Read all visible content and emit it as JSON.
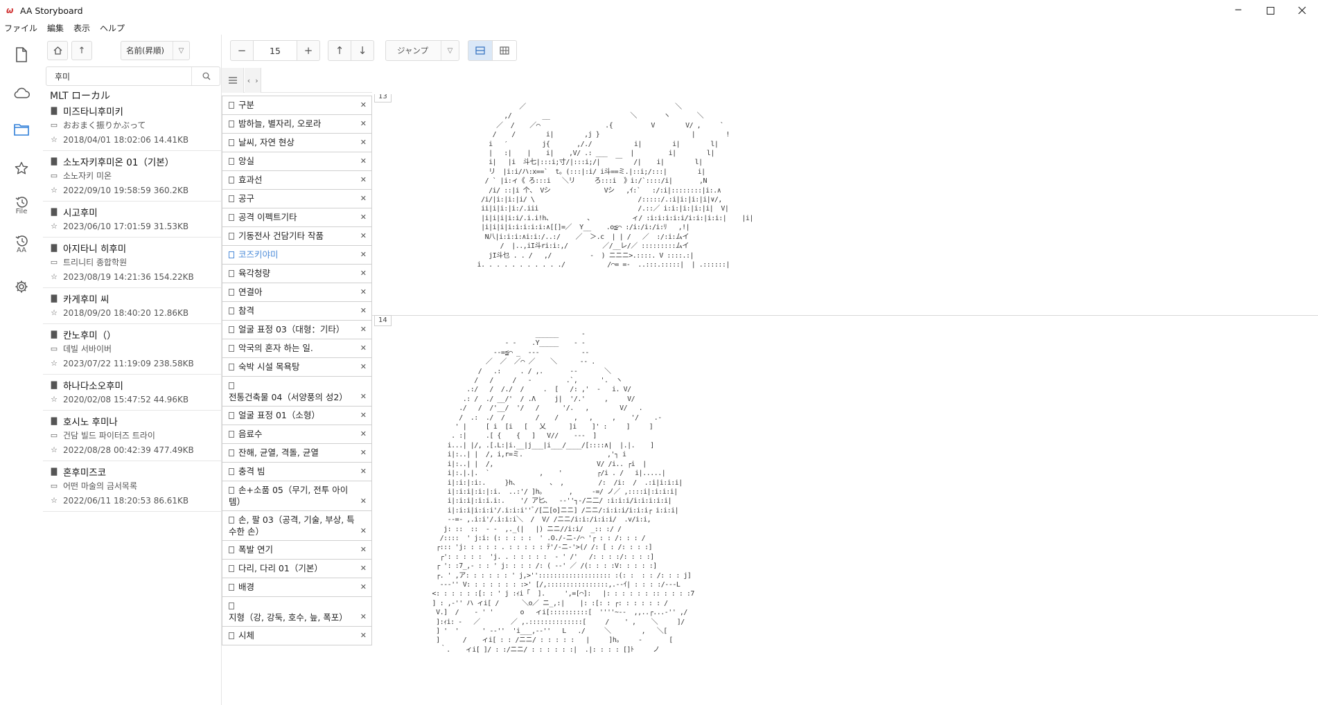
{
  "window": {
    "title": "AA Storyboard",
    "logo": "ω"
  },
  "menu": [
    "ファイル",
    "編集",
    "表示",
    "ヘルプ"
  ],
  "activity": [
    {
      "name": "new-document-icon",
      "label": ""
    },
    {
      "name": "cloud-icon",
      "label": ""
    },
    {
      "name": "folder-icon",
      "label": ""
    },
    {
      "name": "star-icon",
      "label": ""
    },
    {
      "name": "history-file-icon",
      "label": "File"
    },
    {
      "name": "history-aa-icon",
      "label": "AA"
    },
    {
      "name": "settings-gear-icon",
      "label": ""
    }
  ],
  "filepanel": {
    "sort_label": "名前(昇順)",
    "search_value": "후미",
    "location": "MLT ローカル",
    "files": [
      {
        "title": "미즈타니후미키",
        "folder": "おおまく振りかぶって",
        "meta": "2018/04/01 18:02:06 14.41KB"
      },
      {
        "title": "소노자키후미온 01（기본）",
        "folder": "소노자키 미온",
        "meta": "2022/09/10 19:58:59 360.2KB"
      },
      {
        "title": "시고후미",
        "folder": null,
        "meta": "2023/06/10 17:01:59 31.53KB"
      },
      {
        "title": "아지타니 히후미",
        "folder": "트리니티 종합학원",
        "meta": "2023/08/19 14:21:36 154.22KB"
      },
      {
        "title": "카게후미 씨",
        "folder": null,
        "meta": "2018/09/20 18:40:20 12.86KB"
      },
      {
        "title": "칸노후미（）",
        "folder": "데빌 서바이버",
        "meta": "2023/07/22 11:19:09 238.58KB"
      },
      {
        "title": "하나다소오후미",
        "folder": null,
        "meta": "2020/02/08 15:47:52 44.96KB"
      },
      {
        "title": "호시노 후미나",
        "folder": "건담 빌드 파이터즈 트라이",
        "meta": "2022/08/28 00:42:39 477.49KB"
      },
      {
        "title": "혼후미즈코",
        "folder": "어떤 마술의 금서목록",
        "meta": "2022/06/11 18:20:53 86.61KB"
      }
    ]
  },
  "toolbar": {
    "minus": "−",
    "page_value": "15",
    "plus": "+",
    "up": "↑",
    "down": "↓",
    "jump_label": "ジャンプ"
  },
  "sections": [
    {
      "label": "구분"
    },
    {
      "label": "밤하늘, 별자리, 오로라"
    },
    {
      "label": "날씨, 자연 현상"
    },
    {
      "label": "앙실"
    },
    {
      "label": "효과선"
    },
    {
      "label": "공구"
    },
    {
      "label": "공격 이펙트기타"
    },
    {
      "label": "기동전사 건담기타 작품"
    },
    {
      "label": "코즈키야미",
      "selected": true
    },
    {
      "label": "육각청량"
    },
    {
      "label": "연결아"
    },
    {
      "label": "참격"
    },
    {
      "label": "얼굴 표정 03（대형：기타）"
    },
    {
      "label": "악국의 혼자 하는 일."
    },
    {
      "label": "숙박 시설 목욕탕"
    },
    {
      "label": "전통건축물 04（서양풍의 성2）"
    },
    {
      "label": "얼굴 표정 01（소형）"
    },
    {
      "label": "음료수"
    },
    {
      "label": "잔해, 균열, 격돌, 균열"
    },
    {
      "label": "충격 빔"
    },
    {
      "label": "손+소품 05（무기, 전투 아이템）"
    },
    {
      "label": "손, 팔 03（공격, 기술, 부상, 특수한 손）"
    },
    {
      "label": "폭발 연기"
    },
    {
      "label": "다리, 다리 01（기본）"
    },
    {
      "label": "배경"
    },
    {
      "label": "지형（강, 강둑, 호수, 늪, 폭포）"
    },
    {
      "label": "시체"
    }
  ],
  "preview": {
    "pages": [
      "13",
      "14"
    ],
    "art1": "              ／                                       ＼\n          ,/        __                     ＼       ヽ       ＼\n        ／  /    ／⌒                 .{          V        V/ ,     `\n       /    /        i|        ,j }                        |        !\n      i   ′         j{       ,/./           i|        i|        l|\n      |   :|    |    i|    ,V/ .: ___      |         i|        l|\n      i|   |i  斗七|:::i;寸/|:::i;/|    ￣   /|    i|        l|\n      リ  |i:i/ハ:x==`  t。(:::|:i/ i斗==ミ.|::i;/:::|        i|\n     / ` |i:ィ《 ろ:::i   ＼リ     ろ:::i  》i:/`::::/i|       ,N\n      /i/ ::|i 个、 Vシ              Vシ   ,ｲ:`   :/:i|::::::::|i:.∧\n    /i/|i:|i:|i/ \\                           /:::::/.:i|i:|i:|i|∨/,\n    ii|i|i:|i:/.iii                          /.::／ i:i:|i:|i:|i|  V|\n    |i|i|i|i:i/.i.i!h、         、          ィ/ :i:i:i:i:i/i:i:|i:i:|    |i|\n    |i|i|i|i:i:i:i:i:∧[[]=／  Y__    .o≦⌒ :/i:/i:/i:ﾘ   ,!|\n     N八|i:i:i:∧i:i:/..:/    ／  ＞.c  | | /   ／  :/:i:ムイ\n         /  |..,iI斗ri:i:,/         ／/__レ/／ :::::::::ムイ\n      jI斗乜 . . /   ,/          -  ) ニニニ>.::::. V ::::.:|\n   i. . . . . . . . . . ./           /⌒= =-  ..:::.:::::|  | .::::::|",
    "art2": "                              ______      -\n                      - ‐    .Y_____    - ‐\n                   -‐=≦⌒ _  -‐-           ‐-\n                 ／  ／  ／⌒ ／    ＼      ‐- .\n               /   .:     . / ,.       -‐       ＼\n              /   /     /   -         .`,      '.  ヽ\n            .:/   /  /./  /     .  [   /: ,'  -   i. V/\n           .: /  ./ __/'  / .Λ     j|  '/.'     ,     V/\n          ./   /  /'__/  '/   /      '/.   ,        V/   .\n          /  .:  ./  /        /    /    ,   ,     ,    '/    .-\n         ' |     [ i  [i   [   乂      ]i    ]' :     ]     ]\n        . :|     .[ {    {   ]   V//    ‐‐‐  ]\n       i...| |/, .[.L:|i.__|j___|i___/____/[::::∧|  |.|.    ]\n       i|:..| |  /, i,r=ミ.                      ,'┐ i\n       i|:..| |  /,                           V/ /i.. ┌i  |\n       i|:.|.|.  `             ,    '         ┌/i . /   i|.....|\n       i|:i:|:i:.     }h、        、 ,         /:  /i:  /  .:i|i:i:i|\n       i|:i:i|:i:|:i.  ..:'/ ]h。      ,     ‐=/ ノ／ ,::::i|:i:i:i|\n       i|:i:i|:i:i.i:.    '/ ア匕、  -‐''┐-/ニ二/ :i:i:i/i:i:i:i:i|\n       i|:i:i|i:i:i'/.i:i:i''ﾞ/[二[o]ニニ] /ニニ/:i:i:i/i:i:i┌ i:i:i|\n       -‐=‐ ,.i:i'/.i:i:i＼  /  V/ /ニニ/i:i:/i:i:i/  .v/i:i,\n      j: ::  ::  ‐ ‐  ,._(|   |) ニニ//i:i/  _:: :/ /\n     /::::  ' j:i: (: : : : :  ' .O./-ニ-/⌒ '┌ : : /: : : /\n    ┌::: 'j: : : : : . : : : : : ﾃ'/-ニ-'>(/ /: [ : /: : : :]\n     ┌': : : : :  'j. . : : : : :  - ' /'   /: : : :/: : : :]\n    ┌ ': :7_,- : : ' j: : : : /: ( -‐' ／ /(: : : :V: : : : :]\n    ┌. ' ,ア: : : : : : ' j,>''::::::::::::::::::: :(: :  : : /: : : j]\n     -‐‐'' V: : : : : : : :>' [/,::::::::::::::::,.-‐ｲ| : : : :/‐‐‐L\n   <: : : : : :[: : ' j :ｨi「  ].     ',=[⌒]:   |: : : : : : :: : : : :7\n   ] : ,-'' ハ ィi[ /      ＼o／ ニ_,:|    |: :[: : ┌: : : : : : /\n    V.]  /    - ' '       o   ィi[::::::::::[  ''''~-‐  ,,..┌...-'' ,/\n    ]:ｨi: -   ／        ／ ,.::::::::::::::[     /    ' ,    ＼     ]/\n    ] '  '      ' -‐''  'i___,-‐''   L   ./     ＼        ,   ＼[\n    ]      /    ィi[ : : /ニニ/ : : : : :   |     ]h。    -       [\n     ｀.    ィi[ ]/ : :/ニニ/ : : : : : :|  .|: : : : []ﾄ     ノ"
  }
}
